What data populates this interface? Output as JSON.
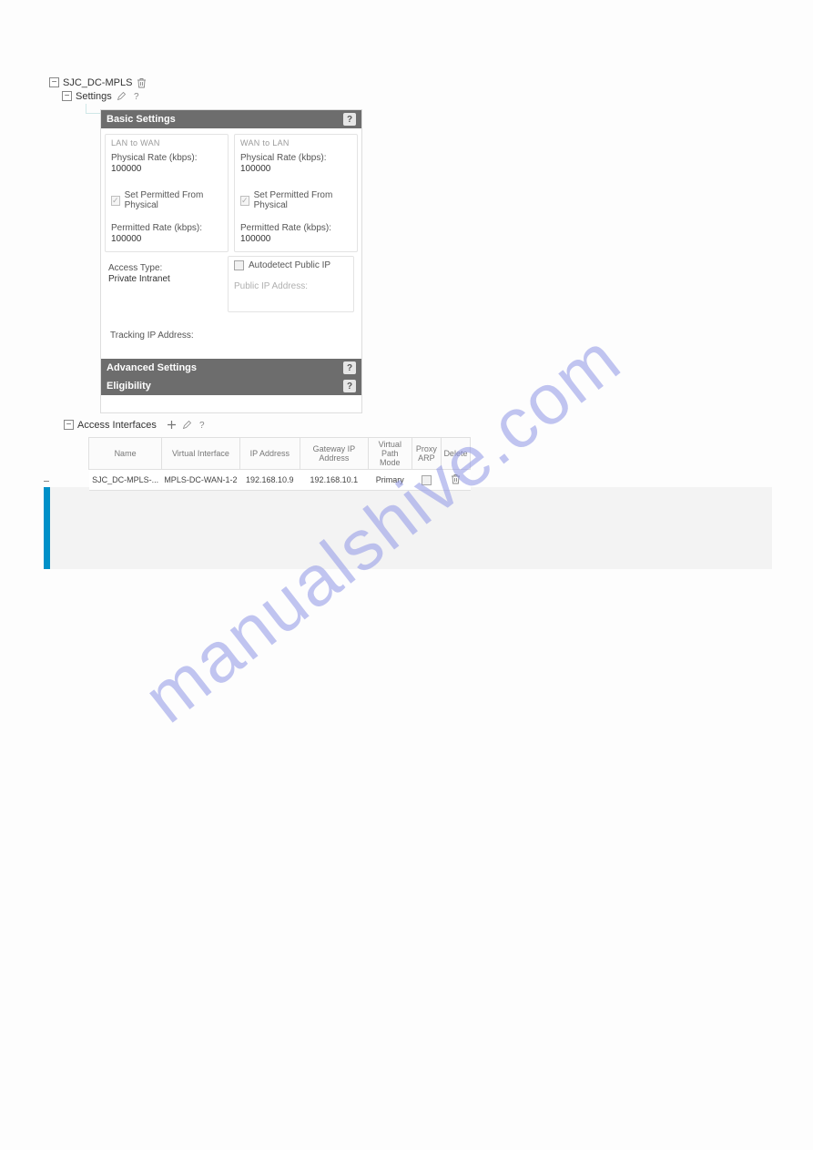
{
  "watermark": "manualshive.com",
  "tree": {
    "root": "SJC_DC-MPLS",
    "settings": "Settings"
  },
  "basic": {
    "title": "Basic Settings",
    "lan_to_wan_h": "LAN to WAN",
    "wan_to_lan_h": "WAN to LAN",
    "phys_rate_lbl": "Physical Rate (kbps):",
    "phys_rate_val_l": "100000",
    "phys_rate_val_r": "100000",
    "set_perm_l": "Set Permitted From Physical",
    "set_perm_r": "Set Permitted From Physical",
    "perm_rate_lbl": "Permitted Rate (kbps):",
    "perm_rate_val_l": "100000",
    "perm_rate_val_r": "100000",
    "access_type_lbl": "Access Type:",
    "access_type_val": "Private Intranet",
    "autodetect": "Autodetect Public IP",
    "pub_ip_lbl": "Public IP Address:",
    "track_lbl": "Tracking IP Address:"
  },
  "advanced": {
    "title": "Advanced Settings"
  },
  "eligibility": {
    "title": "Eligibility"
  },
  "ai": {
    "label": "Access Interfaces",
    "headers": {
      "name": "Name",
      "vif": "Virtual Interface",
      "ip": "IP Address",
      "gw": "Gateway IP Address",
      "vpm": "Virtual Path Mode",
      "parp": "Proxy ARP",
      "del": "Delete"
    },
    "row": {
      "name": "SJC_DC-MPLS-...",
      "vif": "MPLS-DC-WAN-1-2",
      "ip": "192.168.10.9",
      "gw": "192.168.10.1",
      "vpm": "Primary"
    }
  }
}
